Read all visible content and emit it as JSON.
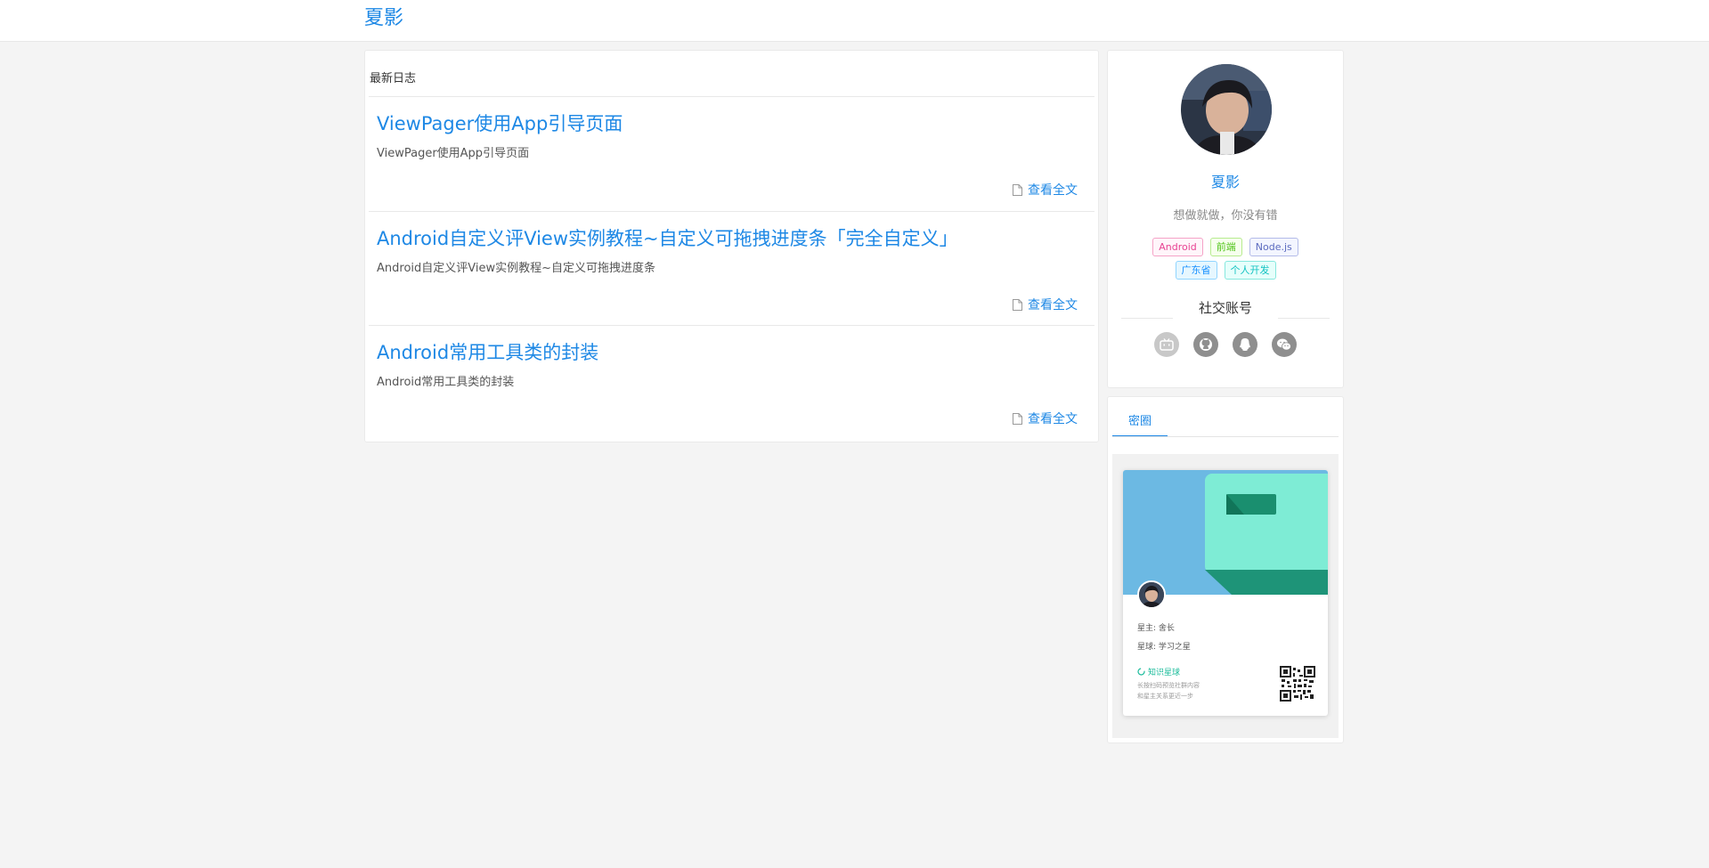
{
  "header": {
    "brand": "夏影"
  },
  "main": {
    "section_title": "最新日志",
    "posts": [
      {
        "title": "ViewPager使用App引导页面",
        "excerpt": "ViewPager使用App引导页面",
        "read_more": "查看全文"
      },
      {
        "title": "Android自定义评View实例教程~自定义可拖拽进度条「完全自定义」",
        "excerpt": "Android自定义评View实例教程~自定义可拖拽进度条",
        "read_more": "查看全文"
      },
      {
        "title": "Android常用工具类的封装",
        "excerpt": "Android常用工具类的封装",
        "read_more": "查看全文"
      }
    ]
  },
  "profile": {
    "name": "夏影",
    "motto": "想做就做，你没有错",
    "tags": [
      {
        "label": "Android",
        "color": "#e84393"
      },
      {
        "label": "前端",
        "color": "#52c41a"
      },
      {
        "label": "Node.js",
        "color": "#5b6abf"
      },
      {
        "label": "广东省",
        "color": "#1890ff"
      },
      {
        "label": "个人开发",
        "color": "#13c2c2"
      }
    ],
    "social_title": "社交账号",
    "socials": [
      {
        "name": "bilibili-icon",
        "color": "#c8c8c8"
      },
      {
        "name": "github-icon",
        "color": "#8f8f8f"
      },
      {
        "name": "qq-icon",
        "color": "#8f8f8f"
      },
      {
        "name": "wechat-icon",
        "color": "#8f8f8f"
      }
    ]
  },
  "circle": {
    "tab_label": "密圈",
    "poster": {
      "owner": "星主: 舍长",
      "planet": "星球: 学习之星",
      "brand": "知识星球",
      "hint_line1": "长按扫码预览社群内容",
      "hint_line2": "和星主关系更近一步"
    }
  },
  "colors": {
    "accent": "#1e88e5",
    "page_bg": "#f4f4f4"
  }
}
